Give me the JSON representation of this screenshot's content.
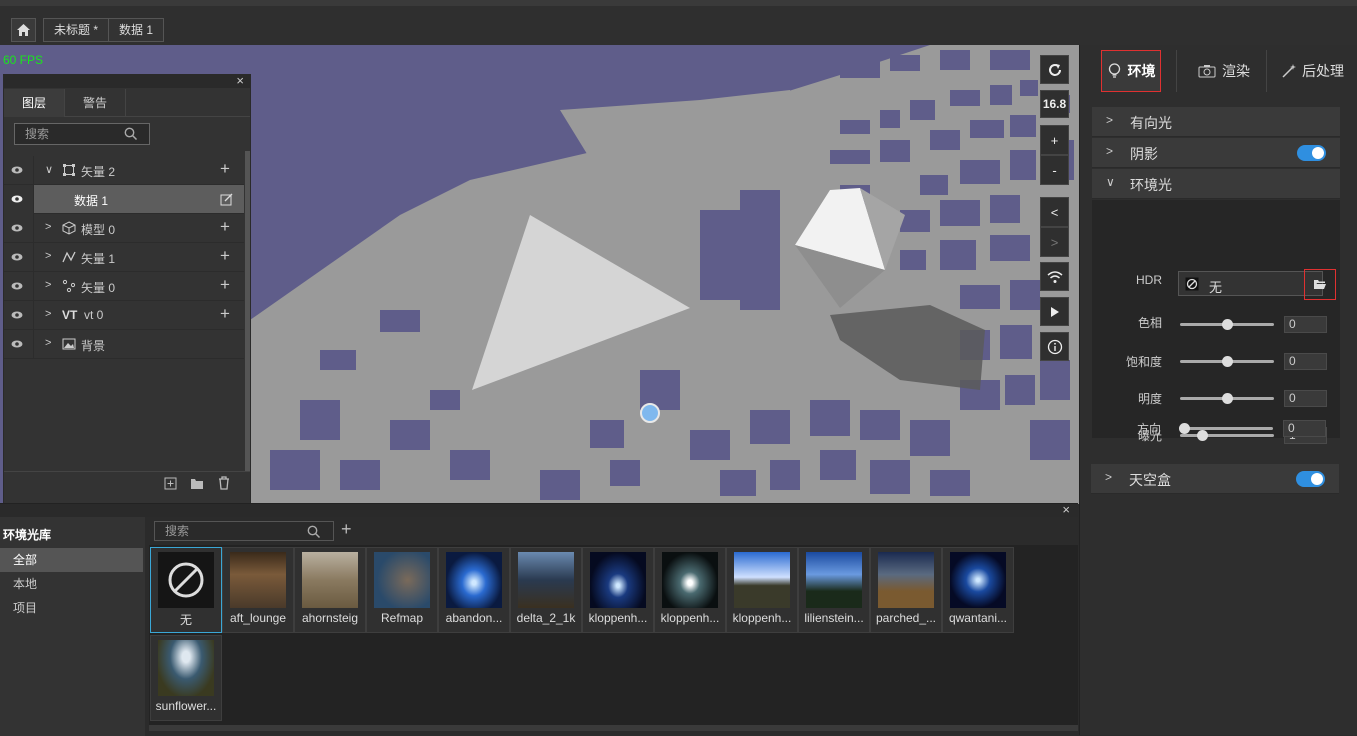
{
  "topbar": {
    "home_icon": "home-icon",
    "breadcrumbs": [
      "未标题 *",
      "数据 1"
    ]
  },
  "viewport": {
    "fps": "60 FPS"
  },
  "layers_panel": {
    "close": "×",
    "tabs": [
      "图层",
      "警告"
    ],
    "search_placeholder": "搜索",
    "rows": [
      {
        "label": "矢量 2",
        "icon": "polygon-icon",
        "expanded": true
      },
      {
        "label": "数据 1",
        "icon": "",
        "selected": true
      },
      {
        "label": "模型 0",
        "icon": "cube-icon"
      },
      {
        "label": "矢量 1",
        "icon": "polyline-icon"
      },
      {
        "label": "矢量 0",
        "icon": "points-icon"
      },
      {
        "label": "vt 0",
        "icon": "vt-icon",
        "prefix": "VT"
      },
      {
        "label": "背景",
        "icon": "image-icon"
      }
    ]
  },
  "right_toolbar": {
    "refresh_icon": "refresh-icon",
    "zoom_level": "16.8",
    "zoom_in": "+",
    "zoom_out": "-",
    "prev": "<",
    "next": ">",
    "wifi_icon": "signal-icon",
    "play_icon": "play-icon",
    "info_icon": "info-icon"
  },
  "right_panel": {
    "tabs": [
      "环境",
      "渲染",
      "后处理"
    ],
    "sections": {
      "directional_light": "有向光",
      "shadow": "阴影",
      "ambient": "环境光",
      "skybox": "天空盒"
    },
    "hdr_label": "HDR",
    "hdr_value": "无",
    "params": [
      {
        "label": "色相",
        "value": "0",
        "pos": 0.5
      },
      {
        "label": "饱和度",
        "value": "0",
        "pos": 0.5
      },
      {
        "label": "明度",
        "value": "0",
        "pos": 0.5
      },
      {
        "label": "曝光",
        "value": "1",
        "pos": 0.2
      },
      {
        "label": "方向",
        "value": "0",
        "pos": 0.0
      }
    ],
    "shadow_enabled": true,
    "skybox_enabled": true,
    "accent": "#2f8fe0"
  },
  "library": {
    "title": "环境光库",
    "close": "×",
    "categories": [
      "全部",
      "本地",
      "项目"
    ],
    "search_placeholder": "搜索",
    "add": "+",
    "items": [
      "无",
      "aft_lounge",
      "ahornsteig",
      "Refmap",
      "abandon...",
      "delta_2_1k",
      "kloppenh...",
      "kloppenh...",
      "kloppenh...",
      "lilienstein...",
      "parched_...",
      "qwantani...",
      "sunflower..."
    ]
  }
}
